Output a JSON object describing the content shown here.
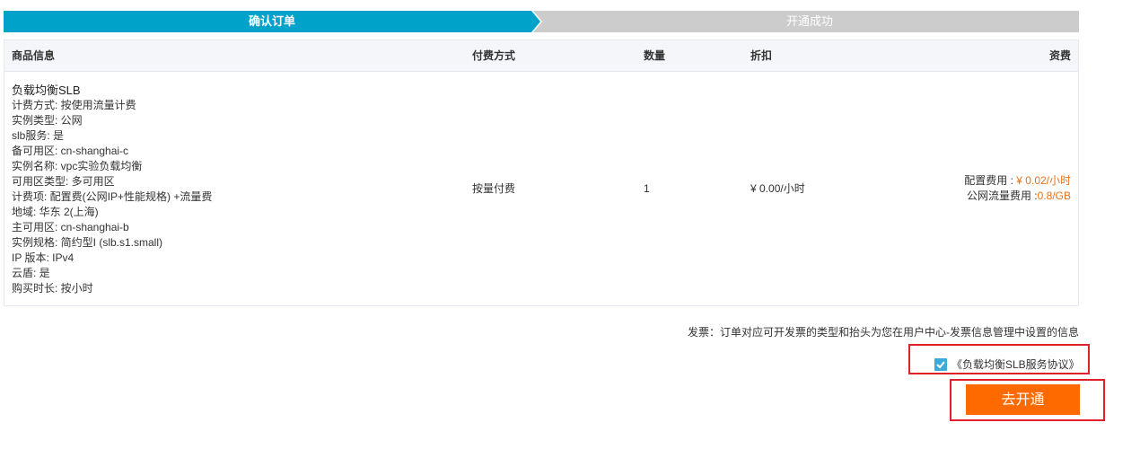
{
  "steps": [
    {
      "label": "确认订单",
      "active": true
    },
    {
      "label": "开通成功",
      "active": false
    }
  ],
  "colors": {
    "step_active": "#00a2ca",
    "step_inactive": "#cccccc",
    "price_accent": "#e8721c",
    "button": "#ff6a00",
    "highlight_border": "#e0202a",
    "checkbox": "#3fa9d8"
  },
  "table": {
    "headers": {
      "product": "商品信息",
      "pay_method": "付费方式",
      "quantity": "数量",
      "discount": "折扣",
      "fee": "资费"
    },
    "row": {
      "product_name": "负载均衡SLB",
      "specs": [
        "计费方式: 按使用流量计费",
        "实例类型: 公网",
        "slb服务: 是",
        "备可用区: cn-shanghai-c",
        "实例名称: vpc实验负载均衡",
        "可用区类型: 多可用区",
        "计费项: 配置费(公网IP+性能规格) +流量费",
        "地域: 华东 2(上海)",
        "主可用区: cn-shanghai-b",
        "实例规格: 简约型I (slb.s1.small)",
        "IP 版本: IPv4",
        "云盾: 是",
        "购买时长: 按小时"
      ],
      "pay_method": "按量付费",
      "quantity": "1",
      "discount": "¥ 0.00/小时",
      "fee": {
        "config_label": "配置费用 : ",
        "config_value": "¥ 0.02/小时",
        "traffic_label": "公网流量费用 :",
        "traffic_value": "0.8/GB"
      }
    }
  },
  "invoice_note": "发票：订单对应可开发票的类型和抬头为您在用户中心-发票信息管理中设置的信息",
  "agreement": {
    "checked": true,
    "label": "《负载均衡SLB服务协议》"
  },
  "open_button": "去开通"
}
